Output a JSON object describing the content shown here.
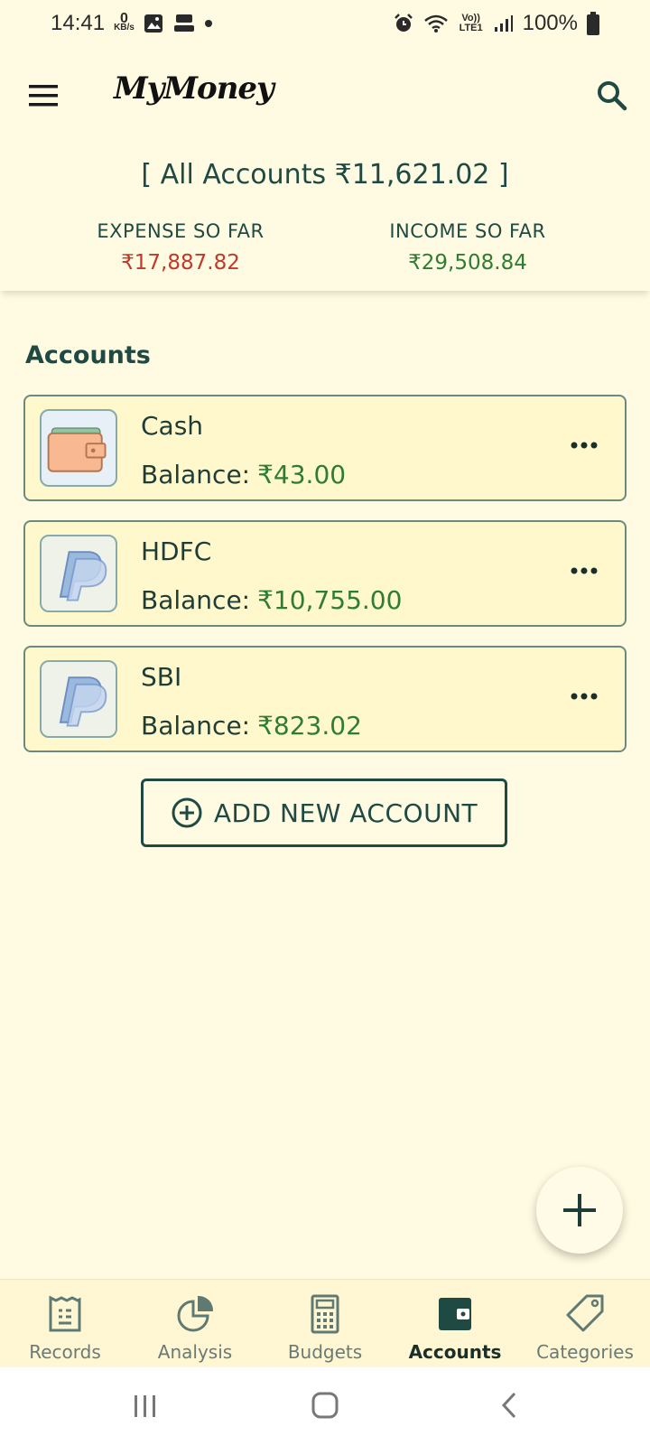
{
  "status_bar": {
    "time": "14:41",
    "net_speed": "0",
    "net_unit": "KB/s",
    "carrier": "Vo)) LTE1",
    "battery": "100%"
  },
  "app_bar": {
    "title": "MyMoney"
  },
  "summary": {
    "all_accounts": "[ All Accounts ₹11,621.02 ]",
    "expense_label": "EXPENSE SO FAR",
    "expense_value": "₹17,887.82",
    "income_label": "INCOME SO FAR",
    "income_value": "₹29,508.84"
  },
  "accounts_section": {
    "title": "Accounts",
    "balance_label": "Balance:",
    "items": [
      {
        "name": "Cash",
        "balance": "₹43.00",
        "icon": "wallet-icon"
      },
      {
        "name": "HDFC",
        "balance": "₹10,755.00",
        "icon": "paypal-icon"
      },
      {
        "name": "SBI",
        "balance": "₹823.02",
        "icon": "paypal-icon"
      }
    ],
    "add_button": "ADD NEW ACCOUNT"
  },
  "bottom_nav": {
    "items": [
      {
        "label": "Records",
        "icon": "records-icon",
        "active": false
      },
      {
        "label": "Analysis",
        "icon": "analysis-icon",
        "active": false
      },
      {
        "label": "Budgets",
        "icon": "calculator-icon",
        "active": false
      },
      {
        "label": "Accounts",
        "icon": "wallet-icon",
        "active": true
      },
      {
        "label": "Categories",
        "icon": "tag-icon",
        "active": false
      }
    ]
  },
  "colors": {
    "background": "#fffbe2",
    "primary": "#1f4a44",
    "expense": "#c0392b",
    "income": "#2e7d32",
    "card": "#fff8cc"
  }
}
